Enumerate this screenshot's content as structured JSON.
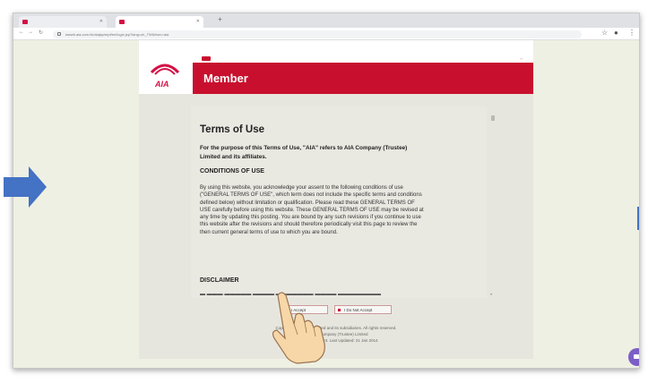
{
  "browser": {
    "tabs": [
      {
        "label": "",
        "active": false
      },
      {
        "label": "",
        "active": true
      }
    ],
    "url": "www6.aia.com.hk/aiajsp/mpf/ee/login.jsp?lang=zh_TW&from=aia"
  },
  "header": {
    "logo_text": "AIA",
    "member_title": "Member"
  },
  "terms": {
    "title": "Terms of Use",
    "intro": "For the purpose of this Terms of Use, \"AIA\" refers to AIA Company (Trustee) Limited and its affiliates.",
    "conditions_heading": "CONDITIONS OF USE",
    "conditions_body": "By using this website, you acknowledge your assent to the following conditions of use (\"GENERAL TERMS OF USE\", which term does not include the specific terms and conditions defined below) without limitation or qualification. Please read these GENERAL TERMS OF USE carefully before using this website. These GENERAL TERMS OF USE may be revised at any time by updating this posting. You are bound by any such revisions if you continue to use this website after the revisions and should therefore periodically visit this page to review the then current general terms of use to which you are bound.",
    "disclaimer_heading": "DISCLAIMER"
  },
  "buttons": {
    "accept": "I Accept",
    "decline": "I Do Not Accept"
  },
  "footer": {
    "line1": "Copyright © 2021 ... Limited and its subsidiaries. All rights reserved.",
    "line2": "\"AIA\" ... Company (Trustee) Limited",
    "line3": "Terms of U... ment. Last Updated: 21 Jan 2014"
  },
  "colors": {
    "brand_red": "#c8102e",
    "arrow_blue": "#4472c4",
    "chat_purple": "#7b5ec6"
  }
}
